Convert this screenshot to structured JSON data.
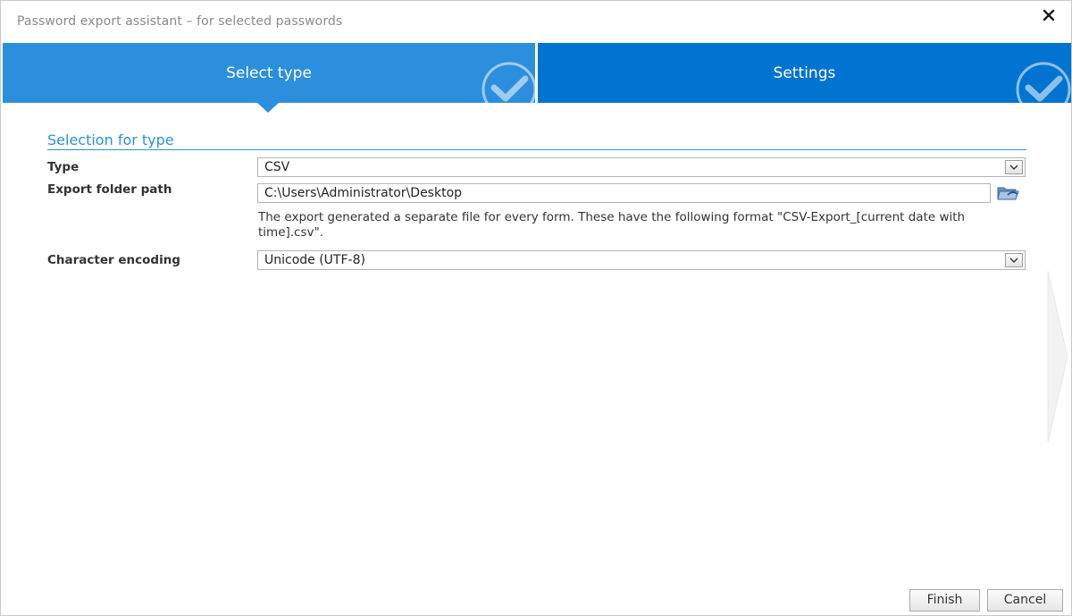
{
  "window": {
    "title": "Password export assistant – for selected passwords"
  },
  "steps": [
    {
      "label": "Select type",
      "state": "active",
      "color": "#2b8fde"
    },
    {
      "label": "Settings",
      "state": "inactive",
      "color": "#0174d2"
    }
  ],
  "section": {
    "title": "Selection for type"
  },
  "form": {
    "type": {
      "label": "Type",
      "value": "CSV"
    },
    "export_folder": {
      "label": "Export folder path",
      "value": "C:\\Users\\Administrator\\Desktop",
      "hint": "The export generated a separate file for every form. These have the following format \"CSV-Export_[current date with time].csv\"."
    },
    "encoding": {
      "label": "Character encoding",
      "value": "Unicode (UTF-8)"
    }
  },
  "footer": {
    "finish_label": "Finish",
    "cancel_label": "Cancel"
  },
  "icons": {
    "close": "close-icon",
    "step_check": "check-circle-icon",
    "dropdown": "chevron-down-icon",
    "folder": "folder-icon",
    "next": "next-arrow-icon"
  },
  "colors": {
    "accent": "#2b8fde",
    "accent_dark": "#0174d2"
  }
}
